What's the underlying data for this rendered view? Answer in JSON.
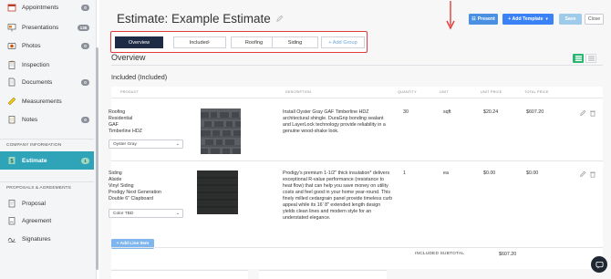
{
  "sidebar": {
    "items": [
      {
        "label": "Appointments",
        "badge": "0",
        "icon": "calendar-icon"
      },
      {
        "label": "Presentations",
        "badge": "136",
        "icon": "presentation-icon"
      },
      {
        "label": "Photos",
        "badge": "0",
        "icon": "camera-icon"
      },
      {
        "label": "Inspection",
        "badge": "",
        "icon": "clipboard-icon"
      },
      {
        "label": "Documents",
        "badge": "0",
        "icon": "document-icon"
      },
      {
        "label": "Measurements",
        "badge": "",
        "icon": "ruler-icon"
      },
      {
        "label": "Notes",
        "badge": "0",
        "icon": "notes-icon"
      }
    ],
    "company_heading": "COMPANY INFORMATION",
    "estimate": {
      "label": "Estimate",
      "badge": "1",
      "icon": "estimate-icon"
    },
    "proposals_heading": "PROPOSALS & AGREEMENTS",
    "proposal_items": [
      {
        "label": "Proposal",
        "icon": "proposal-icon"
      },
      {
        "label": "Agreement",
        "icon": "agreement-icon"
      },
      {
        "label": "Signatures",
        "icon": "signature-icon"
      }
    ]
  },
  "header": {
    "title": "Estimate:  Example Estimate",
    "present_label": "Present",
    "add_template_label": "+ Add Template",
    "save_label": "Save",
    "close_label": "Close"
  },
  "tabs": [
    {
      "label": "Overview",
      "active": true
    },
    {
      "label": "Included",
      "mark": "*"
    },
    {
      "label": "Roofing"
    },
    {
      "label": "Siding"
    },
    {
      "label": "+ Add Group"
    }
  ],
  "section_title": "Overview",
  "group_title": "Included  (Included)",
  "table": {
    "headers": {
      "product": "PRODUCT",
      "description": "DESCRIPTION",
      "quantity": "QUANTITY",
      "unit": "UNIT",
      "unit_price": "UNIT PRICE",
      "total_price": "TOTAL PRICE"
    },
    "rows": [
      {
        "product_lines": [
          "Roofing",
          "Residential",
          "GAF",
          "Timberline HDZ"
        ],
        "color": "Oyster Gray",
        "description": "Install Oyster Gray GAF Timberline HDZ architectural shingle. DuraGrip bonding sealant and LayerLock technology provide reliability in a genuine wood-shake look.",
        "quantity": "30",
        "unit": "sqft",
        "unit_price": "$20.24",
        "total_price": "$607.20"
      },
      {
        "product_lines": [
          "Siding",
          "Alside",
          "Vinyl Siding",
          "Prodigy Next Generation",
          "Double 6\" Clapboard"
        ],
        "color": "Color TBD",
        "description": "Prodigy's premium 1-1/2\" thick insulation* delivers exceptional R-value performance (resistance to heat flow) that can help you save money on utility costs and feel good in your home year-round. This finely milled cedargrain panel provide timeless curb appeal while its 16' 8\" extended length design yields clean lines and modern style for an understated elegance.",
        "quantity": "1",
        "unit": "ea",
        "unit_price": "$0.00",
        "total_price": "$0.00"
      }
    ],
    "add_line_label": "+ Add Line Item",
    "subtotal_label": "INCLUDED SUBTOTAL",
    "subtotal_value": "$607.20"
  },
  "colors": {
    "accent_teal": "#2fa4b9",
    "tab_active": "#1d2b45",
    "highlight_red": "#e23b3b",
    "primary_blue": "#3b82f6",
    "view_green": "#2bb673"
  }
}
